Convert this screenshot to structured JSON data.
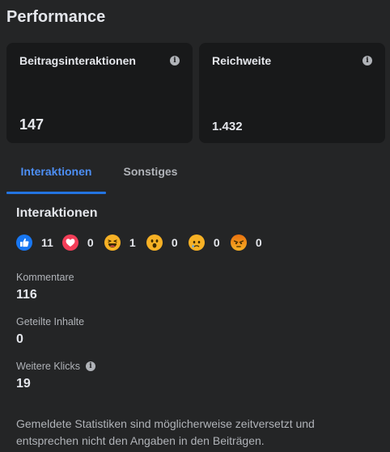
{
  "page": {
    "title": "Performance"
  },
  "cards": [
    {
      "label": "Beitragsinteraktionen",
      "value": "147",
      "info_icon": "info-icon"
    },
    {
      "label": "Reichweite",
      "value": "1.432",
      "info_icon": "info-icon"
    }
  ],
  "tabs": [
    {
      "label": "Interaktionen",
      "active": true
    },
    {
      "label": "Sonstiges",
      "active": false
    }
  ],
  "interactions": {
    "title": "Interaktionen",
    "reactions": [
      {
        "icon": "like-icon",
        "count": "11",
        "color": "#1877f2"
      },
      {
        "icon": "love-icon",
        "count": "0",
        "color": "#f33e58"
      },
      {
        "icon": "haha-icon",
        "count": "1",
        "color": "#f7b125"
      },
      {
        "icon": "wow-icon",
        "count": "0",
        "color": "#f7b125"
      },
      {
        "icon": "sad-icon",
        "count": "0",
        "color": "#f7b125"
      },
      {
        "icon": "angry-icon",
        "count": "0",
        "color": "#e9710f"
      }
    ]
  },
  "stats": [
    {
      "label": "Kommentare",
      "value": "116"
    },
    {
      "label": "Geteilte Inhalte",
      "value": "0"
    },
    {
      "label": "Weitere Klicks",
      "value": "19",
      "info_icon": "info-icon"
    }
  ],
  "note": "Gemeldete Statistiken sind möglicherweise zeitversetzt und entsprechen nicht den Angaben in den Beiträgen.",
  "colors": {
    "background": "#242526",
    "card": "#18191a",
    "accent": "#2374e1",
    "text_primary": "#e4e6eb",
    "text_secondary": "#b0b3b8"
  }
}
